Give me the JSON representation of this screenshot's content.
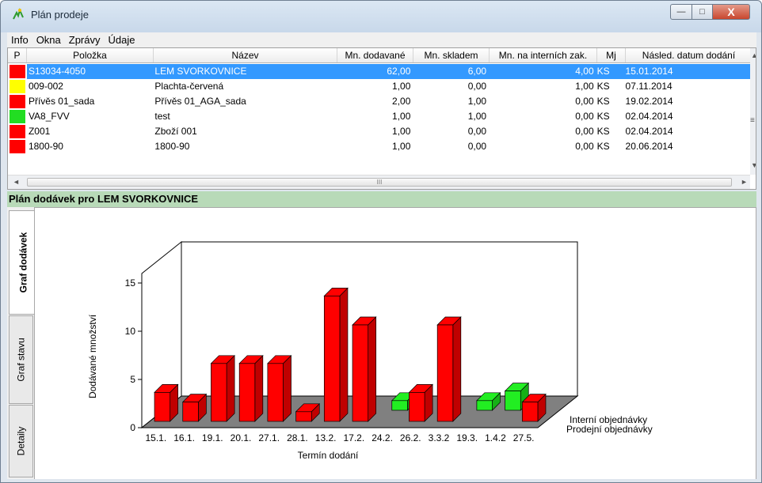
{
  "window": {
    "title": "Plán prodeje",
    "min_glyph": "—",
    "max_glyph": "□",
    "close_glyph": "X"
  },
  "menu": [
    "Info",
    "Okna",
    "Zprávy",
    "Údaje"
  ],
  "grid": {
    "columns": [
      "P",
      "Položka",
      "Název",
      "Mn. dodavané",
      "Mn. skladem",
      "Mn. na interních zak.",
      "Mj",
      "Násled. datum dodání"
    ],
    "rows": [
      {
        "status_color": "#ff0000",
        "polozka": "S13034-4050",
        "nazev": "LEM SVORKOVNICE",
        "dodavane": "62,00",
        "skladem": "6,00",
        "interni": "4,00",
        "mj": "KS",
        "datum": "15.01.2014",
        "selected": true
      },
      {
        "status_color": "#ffff00",
        "polozka": "009-002",
        "nazev": "Plachta-červená",
        "dodavane": "1,00",
        "skladem": "0,00",
        "interni": "1,00",
        "mj": "KS",
        "datum": "07.11.2014",
        "selected": false
      },
      {
        "status_color": "#ff0000",
        "polozka": "Přívěs 01_sada",
        "nazev": "Přívěs 01_AGA_sada",
        "dodavane": "2,00",
        "skladem": "1,00",
        "interni": "0,00",
        "mj": "KS",
        "datum": "19.02.2014",
        "selected": false
      },
      {
        "status_color": "#22dd22",
        "polozka": "VA8_FVV",
        "nazev": "test",
        "dodavane": "1,00",
        "skladem": "1,00",
        "interni": "0,00",
        "mj": "KS",
        "datum": "02.04.2014",
        "selected": false
      },
      {
        "status_color": "#ff0000",
        "polozka": "Z001",
        "nazev": "Zboží 001",
        "dodavane": "1,00",
        "skladem": "0,00",
        "interni": "0,00",
        "mj": "KS",
        "datum": "02.04.2014",
        "selected": false
      },
      {
        "status_color": "#ff0000",
        "polozka": "1800-90",
        "nazev": "1800-90",
        "dodavane": "1,00",
        "skladem": "0,00",
        "interni": "0,00",
        "mj": "KS",
        "datum": "20.06.2014",
        "selected": false
      }
    ],
    "hscroll_glyph": "III"
  },
  "panel": {
    "title": "Plán dodávek pro LEM SVORKOVNICE",
    "tabs": [
      "Graf dodávek",
      "Graf stavu",
      "Detaily"
    ],
    "active_tab": 0
  },
  "colors": {
    "selection": "#3399ff",
    "panel_header": "#b8dab8",
    "bar_red": "#ff0000",
    "bar_green": "#22ee22",
    "floor": "#808080"
  },
  "chart_data": {
    "type": "bar",
    "title": "",
    "xlabel": "Termín dodání",
    "ylabel": "Dodávané množství",
    "ylim": [
      0,
      15
    ],
    "yticks": [
      0,
      5,
      10,
      15
    ],
    "categories": [
      "15.1.",
      "16.1.",
      "19.1.",
      "20.1.",
      "27.1.",
      "28.1.",
      "13.2.",
      "17.2.",
      "24.2.",
      "26.2.",
      "3.3.2",
      "19.3.",
      "1.4.2",
      "27.5."
    ],
    "series": [
      {
        "name": "Interní objednávky",
        "color": "#22ee22",
        "values": [
          0,
          0,
          0,
          0,
          0,
          0,
          0,
          0,
          1,
          0,
          0,
          1,
          2,
          0
        ]
      },
      {
        "name": "Prodejní objednávky",
        "color": "#ff0000",
        "values": [
          3,
          2,
          6,
          6,
          6,
          1,
          13,
          10,
          0,
          3,
          10,
          0,
          0,
          2
        ]
      }
    ],
    "grid": false,
    "legend": "right"
  }
}
